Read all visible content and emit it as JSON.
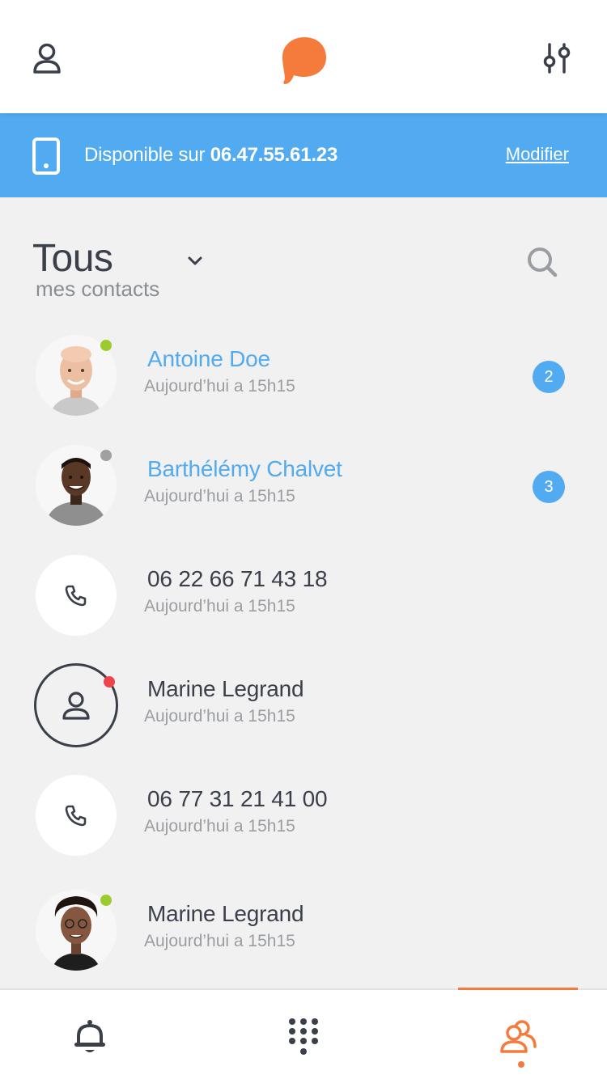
{
  "header": {
    "profile_icon": "user-icon",
    "logo_icon": "speech-bubble-logo",
    "settings_icon": "sliders-icon"
  },
  "banner": {
    "prefix": "Disponible sur ",
    "number": "06.47.55.61.23",
    "link": "Modifier",
    "icon": "smartphone-icon"
  },
  "filter": {
    "title": "Tous",
    "subtitle": "mes contacts",
    "chevron_icon": "chevron-down-icon",
    "search_icon": "search-icon"
  },
  "contacts": [
    {
      "name": "Antoine Doe",
      "time": "Aujourd’hui a 15h15",
      "badge": "2",
      "status": "online",
      "avatar": "photo"
    },
    {
      "name": "Barthélémy Chalvet",
      "time": "Aujourd’hui a 15h15",
      "badge": "3",
      "status": "offline",
      "avatar": "photo"
    },
    {
      "name": "06 22 66 71 43 18",
      "time": "Aujourd’hui a 15h15",
      "badge": "",
      "status": "",
      "avatar": "phone-icon"
    },
    {
      "name": "Marine Legrand",
      "time": "Aujourd’hui a 15h15",
      "badge": "",
      "status": "busy",
      "avatar": "user-outline-icon"
    },
    {
      "name": "06 77 31 21 41 00",
      "time": "Aujourd’hui a 15h15",
      "badge": "",
      "status": "",
      "avatar": "phone-icon"
    },
    {
      "name": "Marine Legrand",
      "time": "Aujourd’hui a 15h15",
      "badge": "",
      "status": "online",
      "avatar": "photo"
    }
  ],
  "tabs": [
    {
      "icon": "bell-icon",
      "active": false
    },
    {
      "icon": "keypad-icon",
      "active": false
    },
    {
      "icon": "contacts-icon",
      "active": true
    }
  ],
  "colors": {
    "accent": "#f47b3c",
    "blue": "#52aaf0",
    "online": "#9ccc2c",
    "offline": "#a0a0a0",
    "busy": "#f0444b",
    "text": "#3a3f4a"
  }
}
